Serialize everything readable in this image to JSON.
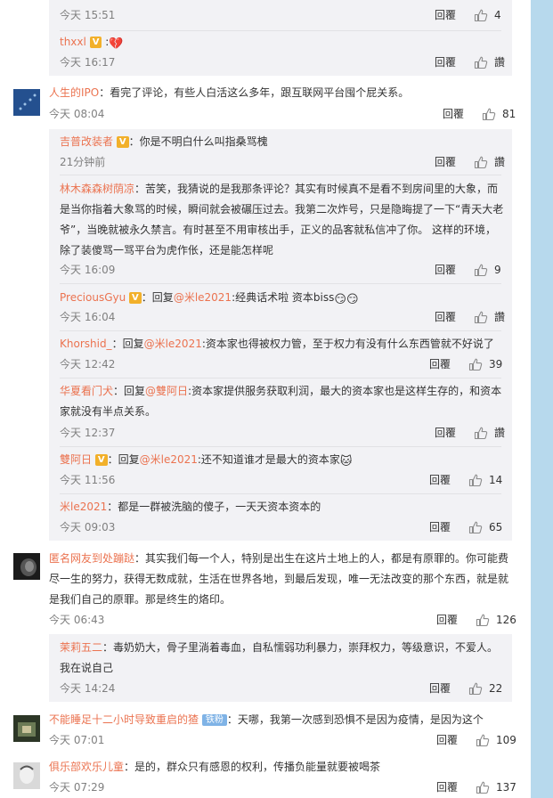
{
  "common": {
    "reply_label": "回覆",
    "zan_label": "讚",
    "vip_badge": "V",
    "fan_badge": "铁粉"
  },
  "comments": {
    "top_remnant": {
      "time": "今天 15:51",
      "likes": "4"
    },
    "thxxl": {
      "nick": "thxxl",
      "time": "今天 16:17"
    },
    "ipo": {
      "nick": "人生的IPO",
      "text": "：看完了评论，有些人白活这么多年，跟互联网平台囤个屁关系。",
      "time": "今天 08:04",
      "likes": "81"
    },
    "r_jipu": {
      "nick": "吉普改装者",
      "text": "：你是不明白什么叫指桑骂槐",
      "time": "21分钟前"
    },
    "r_linmu": {
      "nick": "林木森森树荫凉",
      "line1": "：苦笑，我猜说的是我那条评论？其实有时候真不是看不到房间里的大象，而",
      "line2": "是当你指着大象骂的时候，瞬间就会被碾压过去。我第二次炸号，只是隐晦提了一下“青天大老",
      "line3": "爷”，当晚就被永久禁言。有时甚至不用审核出手，正义的品客就私信冲了你。 这样的环境，",
      "line4": "除了装傻骂一骂平台为虎作伥，还是能怎样呢",
      "time": "今天 16:09",
      "likes": "9"
    },
    "r_precious": {
      "nick": "PreciousGyu",
      "text_a": "：回复",
      "mention": "@米le2021",
      "text_b": ":经典话术啦 资本biss",
      "time": "今天 16:04"
    },
    "r_khorshid": {
      "nick": "Khorshid_",
      "text_a": "：回复",
      "mention": "@米le2021",
      "text_b": ":资本家也得被权力管，至于权力有没有什么东西管就不好说了",
      "time": "今天 12:42",
      "likes": "39"
    },
    "r_huaxia": {
      "nick": "华夏看门犬",
      "text_a": "：回复",
      "mention": "@雙阿日",
      "text_b": ":资本家提供服务获取利润，最大的资本家也是这样生存的，和资本",
      "line2": "家就没有半点关系。",
      "time": "今天 12:37"
    },
    "r_shuangari": {
      "nick": "雙阿日",
      "text_a": "：回复",
      "mention": "@米le2021",
      "text_b": ":还不知道谁才是最大的资本家",
      "time": "今天 11:56",
      "likes": "14"
    },
    "r_mile": {
      "nick": "米le2021",
      "text": "：都是一群被洗脑的傻子，一天天资本资本的",
      "time": "今天 09:03",
      "likes": "65"
    },
    "niming": {
      "nick": "匿名网友到处蹦跶",
      "line1": "：其实我们每一个人，特别是出生在这片土地上的人，都是有原罪的。你可能费",
      "line2": "尽一生的努力，获得无数成就，生活在世界各地，到最后发现，唯一无法改变的那个东西，就是就",
      "line3": "是我们自己的原罪。那是终生的烙印。",
      "time": "今天 06:43",
      "likes": "126"
    },
    "r_moli": {
      "nick": "茉莉五二",
      "text": "：毒奶奶大，骨子里淌着毒血，自私懦弱功利暴力，崇拜权力，等级意识，不爱人。",
      "line2": "我在说自己",
      "time": "今天 14:24",
      "likes": "22"
    },
    "buneng": {
      "nick": "不能睡足十二小时导致重启的猹",
      "text": "：天哪，我第一次感到恐惧不是因为疫情，是因为这个",
      "time": "今天 07:01",
      "likes": "109"
    },
    "julebu": {
      "nick": "俱乐部欢乐儿童",
      "text": "：是的，群众只有感恩的权利，传播负能量就要被喝茶",
      "time": "今天 07:29",
      "likes": "137"
    }
  }
}
